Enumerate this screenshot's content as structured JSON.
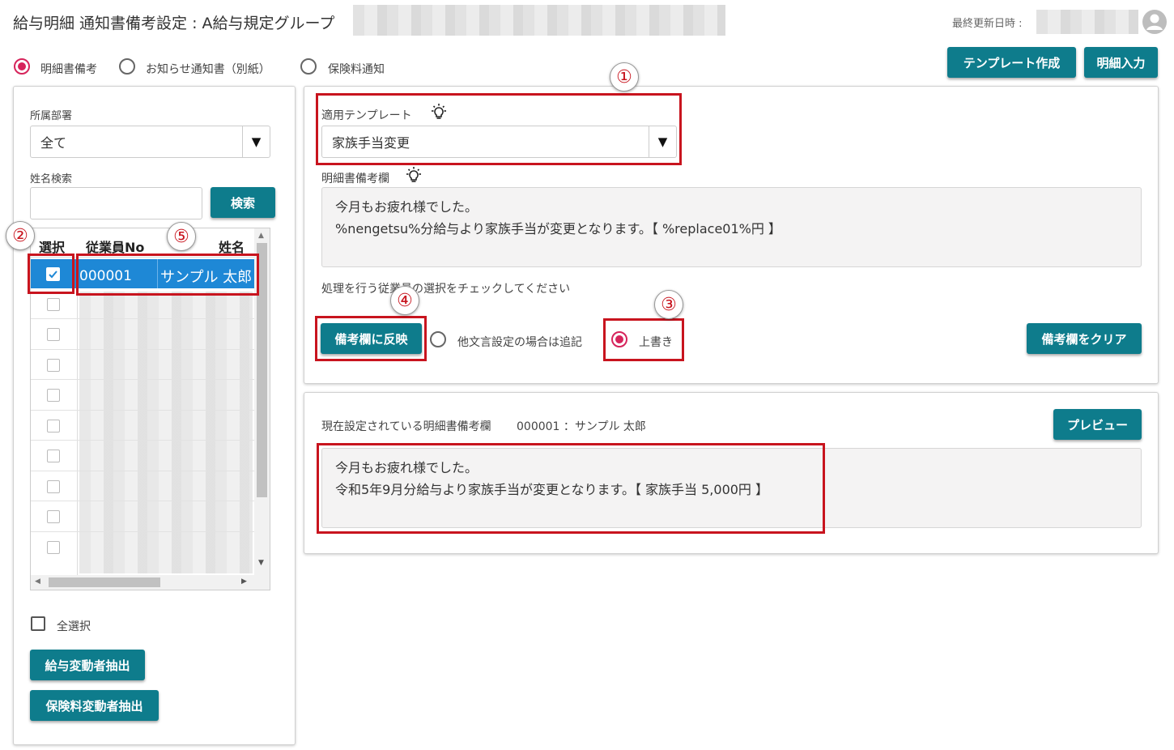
{
  "header": {
    "title": "給与明細 通知書備考設定 : A給与規定グループ",
    "last_updated_label": "最終更新日時 :"
  },
  "notice_type": {
    "options": [
      "明細書備考",
      "お知らせ通知書（別紙）",
      "保険料通知"
    ],
    "selected": "明細書備考"
  },
  "toolbar": {
    "template_create_label": "テンプレート作成",
    "detail_input_label": "明細入力"
  },
  "left_panel": {
    "department_label": "所属部署",
    "department_value": "全て",
    "name_search_label": "姓名検索",
    "name_search_value": "",
    "search_button_label": "検索",
    "table_headers": [
      "選択",
      "従業員No",
      "姓名"
    ],
    "rows": [
      {
        "selected": true,
        "employee_no": "000001",
        "name": "サンプル 太郎"
      }
    ],
    "select_all_label": "全選択",
    "extract_salary_change_label": "給与変動者抽出",
    "extract_insurance_change_label": "保険料変動者抽出"
  },
  "template_panel": {
    "applied_template_label": "適用テンプレート",
    "applied_template_value": "家族手当変更",
    "remarks_label": "明細書備考欄",
    "remarks_lines": [
      "今月もお疲れ様でした。",
      "%nengetsu%分給与より家族手当が変更となります。【 %replace01%円 】"
    ],
    "instruction_text": "処理を行う従業員の選択をチェックしてください",
    "apply_button_label": "備考欄に反映",
    "append_option_label": "他文言設定の場合は追記",
    "overwrite_option_label": "上書き",
    "write_mode_selected": "上書き",
    "clear_button_label": "備考欄をクリア"
  },
  "current_panel": {
    "current_label": "現在設定されている明細書備考欄",
    "employee_info": "000001 ：サンプル 太郎",
    "preview_button_label": "プレビュー",
    "current_lines": [
      "今月もお疲れ様でした。",
      "令和5年9月分給与より家族手当が変更となります。【 家族手当 5,000円 】"
    ]
  },
  "annotations": {
    "markers": [
      "①",
      "②",
      "③",
      "④",
      "⑤"
    ],
    "color": "#c8141e"
  },
  "colors": {
    "accent": "#0e7c8c",
    "radio_active": "#d6245b",
    "row_selected": "#1e88d6"
  },
  "icons": [
    "lightbulb-icon",
    "avatar-icon",
    "check-icon",
    "chevron-down-icon"
  ]
}
